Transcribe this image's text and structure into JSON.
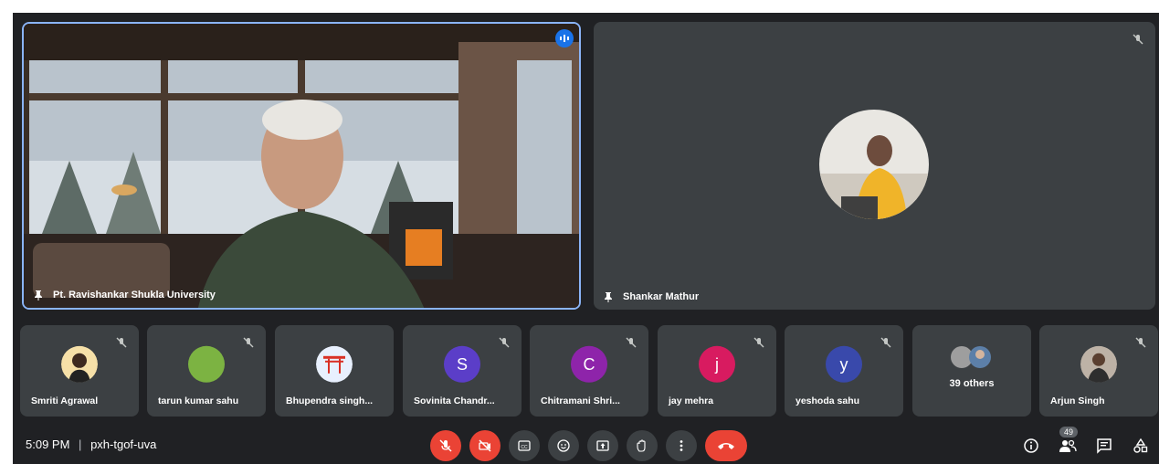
{
  "main": {
    "presenter_name": "Pt. Ravishankar Shukla University",
    "second_name": "Shankar Mathur"
  },
  "participants": [
    {
      "name": "Smriti Agrawal",
      "avatar_type": "photo",
      "avatar_color": "#f1c40f",
      "muted": true
    },
    {
      "name": "tarun kumar sahu",
      "avatar_type": "color",
      "avatar_color": "#7cb342",
      "muted": true
    },
    {
      "name": "Bhupendra singh...",
      "avatar_type": "gate",
      "avatar_color": "#e8f0fe",
      "muted": false
    },
    {
      "name": "Sovinita Chandr...",
      "initial": "S",
      "avatar_type": "letter",
      "avatar_color": "#5b3ec8",
      "muted": true
    },
    {
      "name": "Chitramani Shri...",
      "initial": "C",
      "avatar_type": "letter",
      "avatar_color": "#8e24aa",
      "muted": true
    },
    {
      "name": "jay mehra",
      "initial": "j",
      "avatar_type": "letter",
      "avatar_color": "#d81b60",
      "muted": true
    },
    {
      "name": "yeshoda sahu",
      "initial": "y",
      "avatar_type": "letter",
      "avatar_color": "#3949ab",
      "muted": true
    },
    {
      "name": "39 others",
      "avatar_type": "group",
      "muted": false
    },
    {
      "name": "Arjun Singh",
      "avatar_type": "photo",
      "avatar_color": "#8d6e63",
      "muted": true
    }
  ],
  "bar": {
    "time": "5:09 PM",
    "separator": "|",
    "meeting_code": "pxh-tgof-uva",
    "people_count": "49"
  },
  "colors": {
    "background": "#202124",
    "tile": "#3c4043",
    "accent": "#8ab4f8",
    "danger": "#ea4335"
  }
}
